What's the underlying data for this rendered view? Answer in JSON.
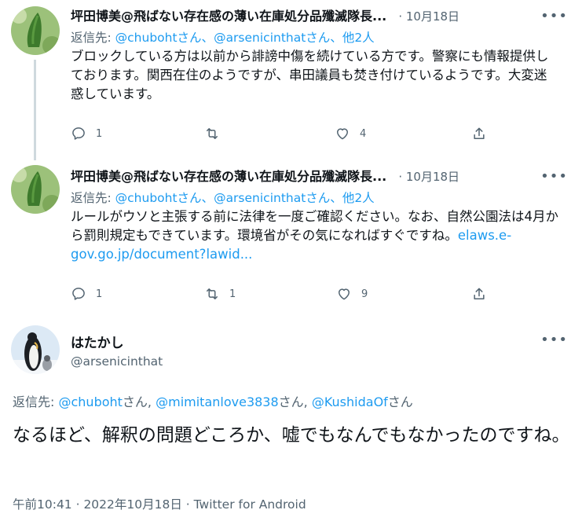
{
  "tweets": [
    {
      "author": "坪田博美@飛ばない存在感の薄い在庫処分品殲滅隊長...",
      "date": "· 10月18日",
      "reply_prefix": "返信先: ",
      "reply_to": [
        "@chubohtさん、",
        "@arsenicinthatさん、",
        "他2人"
      ],
      "text": "ブロックしている方は以前から誹謗中傷を続けている方です。警察にも情報提供しております。関西在住のようですが、串田議員も焚き付けているようです。大変迷惑しています。",
      "link": "",
      "counts": {
        "reply": "1",
        "retweet": "",
        "like": "4"
      }
    },
    {
      "author": "坪田博美@飛ばない存在感の薄い在庫処分品殲滅隊長...",
      "date": "· 10月18日",
      "reply_prefix": "返信先: ",
      "reply_to": [
        "@chubohtさん、",
        "@arsenicinthatさん、",
        "他2人"
      ],
      "text": "ルールがウソと主張する前に法律を一度ご確認ください。なお、自然公園法は4月から罰則規定もできています。環境省がその気になればすぐですね。",
      "link": "elaws.e-gov.go.jp/document?lawid...",
      "counts": {
        "reply": "1",
        "retweet": "1",
        "like": "9"
      }
    }
  ],
  "main": {
    "name": "はたかし",
    "handle": "@arsenicinthat",
    "reply_prefix": "返信先: ",
    "reply_to": [
      {
        "handle": "@chuboht",
        "suffix": "さん, "
      },
      {
        "handle": "@mimitanlove3838",
        "suffix": "さん, "
      },
      {
        "handle": "@KushidaOf",
        "suffix": "さん"
      }
    ],
    "text": "なるほど、解釈の問題どころか、嘘でもなんでもなかったのですね。",
    "meta": "午前10:41 · 2022年10月18日 · Twitter for Android"
  },
  "icons": {
    "more": "more-dots-icon",
    "reply": "reply-bubble-icon",
    "retweet": "retweet-icon",
    "like": "heart-icon",
    "share": "share-upload-icon"
  },
  "colors": {
    "link": "#1d9bf0",
    "muted": "#536471",
    "text": "#0f1419"
  }
}
